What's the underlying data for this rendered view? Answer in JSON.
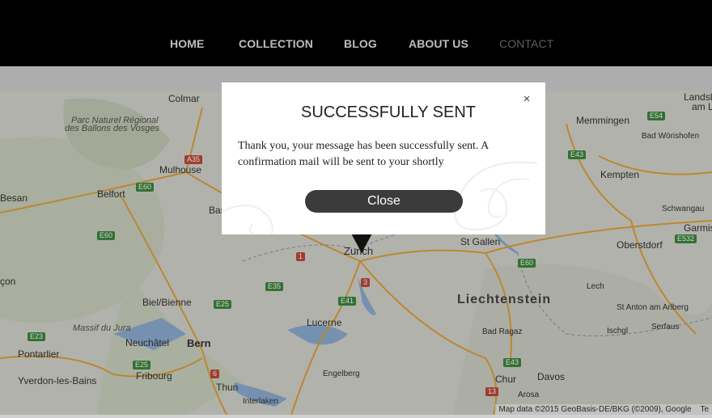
{
  "nav": {
    "items": [
      {
        "label": "HOME"
      },
      {
        "label": "COLLECTION"
      },
      {
        "label": "BLOG"
      },
      {
        "label": "ABOUT US"
      },
      {
        "label": "CONTACT",
        "active": true
      }
    ]
  },
  "map": {
    "places": [
      "Colmar",
      "Parc Naturel Régional",
      "des Ballons des Vosges",
      "Mulhouse",
      "Belfort",
      "Biel/Bienne",
      "Massif du Jura",
      "Neuchâtel",
      "Bern",
      "Pontarlier",
      "Yverdon-les-Bains",
      "Fribourg",
      "Thun",
      "Interlaken",
      "Lucerne",
      "Engelberg",
      "Zurich",
      "St Gallen",
      "Liechtenstein",
      "Bad Ragaz",
      "Chur",
      "Davos",
      "Arosa",
      "Memmingen",
      "Bad Wörishofen",
      "Kempten",
      "Schwangau",
      "Garmis",
      "Oberstdorf",
      "Lech",
      "St Anton am Arlberg",
      "Ischgl",
      "Serfaus",
      "Landsb",
      "am Le",
      "Bas",
      "Besan",
      "çon"
    ],
    "highways": [
      "A35",
      "E60",
      "E60",
      "E25",
      "E35",
      "E23",
      "E25",
      "6",
      "1",
      "3",
      "E41",
      "E43",
      "13",
      "E60",
      "E54",
      "E43",
      "E532"
    ],
    "attribution": "Map data ©2015 GeoBasis-DE/BKG (©2009), Google",
    "attribution_extra": "Te"
  },
  "modal": {
    "title": "SUCCESSFULLY SENT",
    "message": "Thank you, your message has been successfully sent. A confirmation mail will be sent to your shortly",
    "close_label": "Close",
    "close_icon": "×"
  }
}
